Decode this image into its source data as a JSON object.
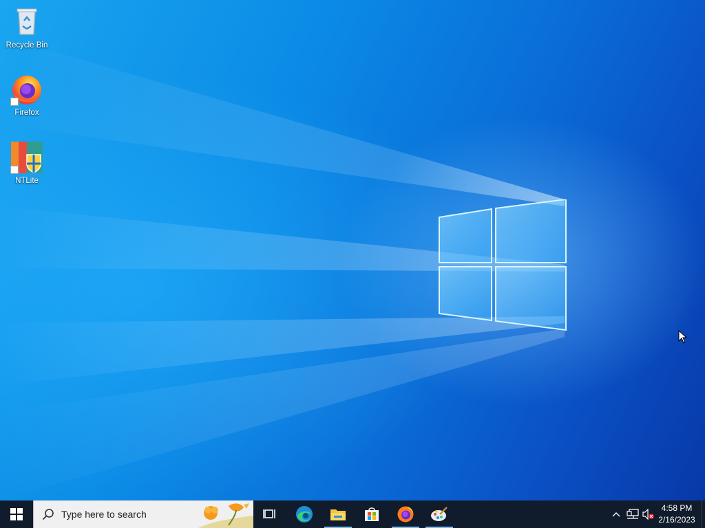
{
  "desktop": {
    "icons": [
      {
        "label": "Recycle Bin",
        "icon": "recycle-bin-icon"
      },
      {
        "label": "Firefox",
        "icon": "firefox-icon"
      },
      {
        "label": "NTLite",
        "icon": "ntlite-icon"
      }
    ]
  },
  "taskbar": {
    "start": {
      "icon": "windows-start-icon"
    },
    "search": {
      "placeholder": "Type here to search",
      "icon": "search-icon"
    },
    "pinned": [
      {
        "name": "Task View",
        "icon": "task-view-icon",
        "running": false
      },
      {
        "name": "Microsoft Edge",
        "icon": "edge-icon",
        "running": false
      },
      {
        "name": "File Explorer",
        "icon": "file-explorer-icon",
        "running": true
      },
      {
        "name": "Microsoft Store",
        "icon": "store-icon",
        "running": false
      },
      {
        "name": "Firefox",
        "icon": "firefox-icon",
        "running": true
      },
      {
        "name": "Paint",
        "icon": "paint-icon",
        "running": true
      }
    ],
    "tray": {
      "icons": [
        "chevron-up-icon",
        "network-icon",
        "volume-muted-icon"
      ]
    },
    "clock": {
      "time": "4:58 PM",
      "date": "2/16/2023"
    }
  },
  "colors": {
    "taskbar": "#101b2b",
    "accent": "#7ab8ef",
    "desktop_blue": "#0a6fd8"
  }
}
